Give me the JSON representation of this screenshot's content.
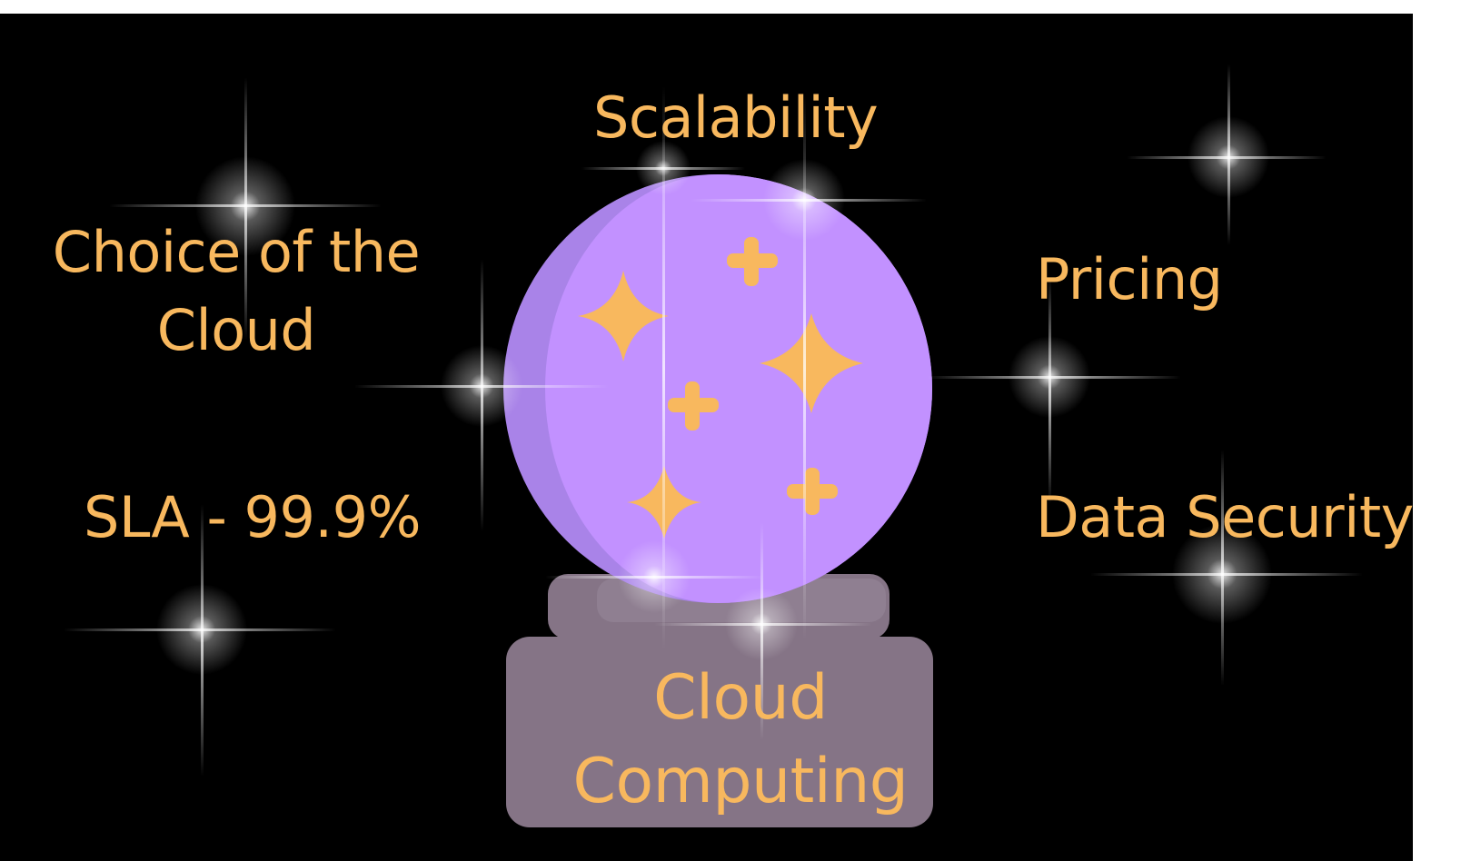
{
  "labels": {
    "scalability": "Scalability",
    "choice_of_cloud": "Choice of the Cloud",
    "pricing": "Pricing",
    "sla": "SLA - 99.9%",
    "data_security": "Data Security",
    "cloud_computing": "Cloud Computing"
  },
  "colors": {
    "background": "#000000",
    "text": "#f8b85e",
    "orb": "#c291ff",
    "orb_shadow": "#a983e8",
    "base": "#857486",
    "base_top": "#8f7f91",
    "sparkle": "#f8b85e"
  },
  "icons": {
    "crystal_ball": "crystal-ball-icon",
    "sparkle": "sparkle-star-icon",
    "twinkle": "twinkle-star-icon"
  }
}
